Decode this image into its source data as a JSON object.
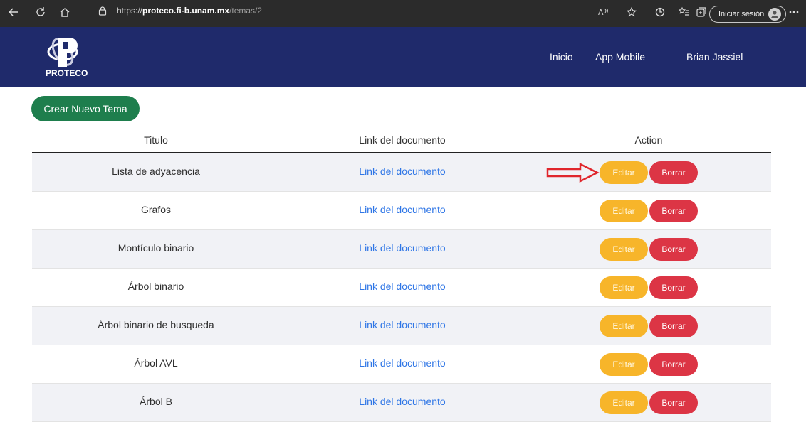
{
  "browser": {
    "url_prefix": "https://",
    "url_host": "proteco.fi-b.unam.mx",
    "url_path": "/temas/2",
    "login_label": "Iniciar sesión",
    "icons": [
      "back-icon",
      "refresh-icon",
      "home-icon",
      "lock-icon",
      "read-aloud-icon",
      "favorite-icon",
      "extensions-icon",
      "favorites-list-icon",
      "collections-icon",
      "more-icon"
    ]
  },
  "navbar": {
    "logo_text": "PROTECO",
    "items": [
      "Inicio",
      "App Mobile",
      "Brian Jassiel"
    ],
    "background": "#1f2a6b"
  },
  "create_button": "Crear Nuevo Tema",
  "table": {
    "headers": [
      "Titulo",
      "Link del documento",
      "Action"
    ],
    "rows": [
      {
        "title": "Lista de adyacencia",
        "link": "Link del documento",
        "edit": "Editar",
        "delete": "Borrar"
      },
      {
        "title": "Grafos",
        "link": "Link del documento",
        "edit": "Editar",
        "delete": "Borrar"
      },
      {
        "title": "Montículo binario",
        "link": "Link del documento",
        "edit": "Editar",
        "delete": "Borrar"
      },
      {
        "title": "Árbol binario",
        "link": "Link del documento",
        "edit": "Editar",
        "delete": "Borrar"
      },
      {
        "title": "Árbol binario de busqueda",
        "link": "Link del documento",
        "edit": "Editar",
        "delete": "Borrar"
      },
      {
        "title": "Árbol AVL",
        "link": "Link del documento",
        "edit": "Editar",
        "delete": "Borrar"
      },
      {
        "title": "Árbol B",
        "link": "Link del documento",
        "edit": "Editar",
        "delete": "Borrar"
      }
    ]
  },
  "colors": {
    "edit": "#f7b52a",
    "delete": "#dc3545",
    "create": "#1e7e4d",
    "link": "#2f76e6",
    "annotation_arrow": "#e0262c"
  }
}
